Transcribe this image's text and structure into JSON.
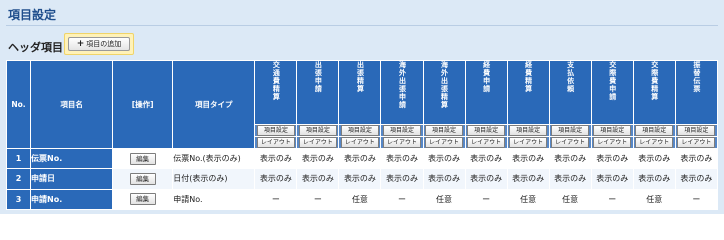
{
  "page": {
    "title": "項目設定"
  },
  "header_section": {
    "title": "ヘッダ項目",
    "add_button_label": "項目の追加"
  },
  "table": {
    "head": {
      "no": "No.",
      "item_name": "項目名",
      "operation": "[操作]",
      "item_type": "項目タイプ"
    },
    "columns": [
      {
        "label": "交通費精算"
      },
      {
        "label": "出張申請"
      },
      {
        "label": "出張精算"
      },
      {
        "label": "海外出張申請"
      },
      {
        "label": "海外出張精算"
      },
      {
        "label": "経費申請"
      },
      {
        "label": "経費精算"
      },
      {
        "label": "支払依頼"
      },
      {
        "label": "交際費申請"
      },
      {
        "label": "交際費精算"
      },
      {
        "label": "振替伝票"
      }
    ],
    "column_button_1": "項目設定",
    "column_button_2": "レイアウト",
    "edit_button": "編集",
    "rows": [
      {
        "no": "1",
        "name": "伝票No.",
        "type": "伝票No.(表示のみ)",
        "values": [
          "表示のみ",
          "表示のみ",
          "表示のみ",
          "表示のみ",
          "表示のみ",
          "表示のみ",
          "表示のみ",
          "表示のみ",
          "表示のみ",
          "表示のみ",
          "表示のみ"
        ]
      },
      {
        "no": "2",
        "name": "申請日",
        "type": "日付(表示のみ)",
        "values": [
          "表示のみ",
          "表示のみ",
          "表示のみ",
          "表示のみ",
          "表示のみ",
          "表示のみ",
          "表示のみ",
          "表示のみ",
          "表示のみ",
          "表示のみ",
          "表示のみ"
        ]
      },
      {
        "no": "3",
        "name": "申請No.",
        "type": "申請No.",
        "values": [
          "ー",
          "ー",
          "任意",
          "ー",
          "任意",
          "ー",
          "任意",
          "任意",
          "ー",
          "任意",
          "ー"
        ]
      }
    ]
  }
}
